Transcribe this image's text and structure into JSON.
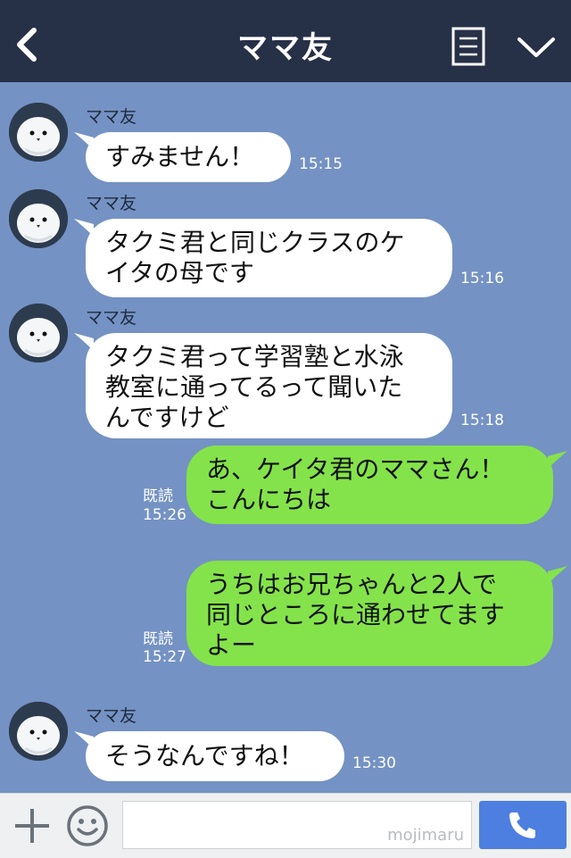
{
  "header": {
    "title": "ママ友"
  },
  "messages": [
    {
      "sender": "ママ友",
      "text": "すみません！",
      "time": "15:15"
    },
    {
      "sender": "ママ友",
      "text": "タクミ君と同じクラスのケ\nイタの母です",
      "time": "15:16"
    },
    {
      "sender": "ママ友",
      "text": "タクミ君って学習塾と水泳\n教室に通ってるって聞いた\nんですけど",
      "time": "15:18"
    },
    {
      "text": "あ、ケイタ君のママさん！\nこんにちは",
      "read": "既読",
      "time": "15:26"
    },
    {
      "text": "うちはお兄ちゃんと2人で\n同じところに通わせてます\nよー",
      "read": "既読",
      "time": "15:27"
    },
    {
      "sender": "ママ友",
      "text": "そうなんですね！",
      "time": "15:30"
    }
  ],
  "input": {
    "watermark": "mojimaru"
  },
  "colors": {
    "header_bg": "#263047",
    "chat_bg": "#7492c3",
    "incoming_bubble": "#ffffff",
    "outgoing_bubble": "#84e34a",
    "send_button": "#4d7fe0"
  }
}
